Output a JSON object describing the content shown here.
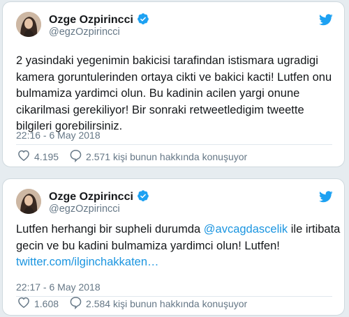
{
  "colors": {
    "background": "#e6ecf0",
    "card": "#ffffff",
    "text": "#14171a",
    "muted": "#657786",
    "link": "#1b95e0",
    "verified": "#1da1f2"
  },
  "icons": {
    "verified": "verified-badge-icon",
    "logo": "twitter-bird-icon",
    "like": "heart-icon",
    "reply": "speech-bubble-icon"
  },
  "tweets": [
    {
      "author": {
        "name": "Ozge Ozpirincci",
        "handle": "@egzOzpirincci"
      },
      "text_lines": [
        "2 yasindaki yegenimin bakicisi tarafindan istismara ugradigi",
        "kamera goruntulerinden ortaya cikti ve bakici kacti! Lutfen onu",
        "bulmamiza yardimci olun. Bu kadinin acilen yargi onune",
        "cikarilmasi gerekiliyor!  Bir sonraki retweetledigim tweette",
        "bilgileri gorebilirsiniz."
      ],
      "timestamp": "22:16 - 6 May 2018",
      "likes": "4.195",
      "conversation": "2.571 kişi bunun hakkında konuşuyor"
    },
    {
      "author": {
        "name": "Ozge Ozpirincci",
        "handle": "@egzOzpirincci"
      },
      "text": {
        "line1_before": "Lutfen herhangi bir supheli durumda ",
        "mention": "@avcagdascelik",
        "line1_after": " ile irtibata",
        "line2": "gecin ve bu kadini bulmamiza yardimci olun! Lutfen!",
        "link": "twitter.com/ilginchakkaten…"
      },
      "timestamp": "22:17 - 6 May 2018",
      "likes": "1.608",
      "conversation": "2.584 kişi bunun hakkında konuşuyor"
    }
  ]
}
